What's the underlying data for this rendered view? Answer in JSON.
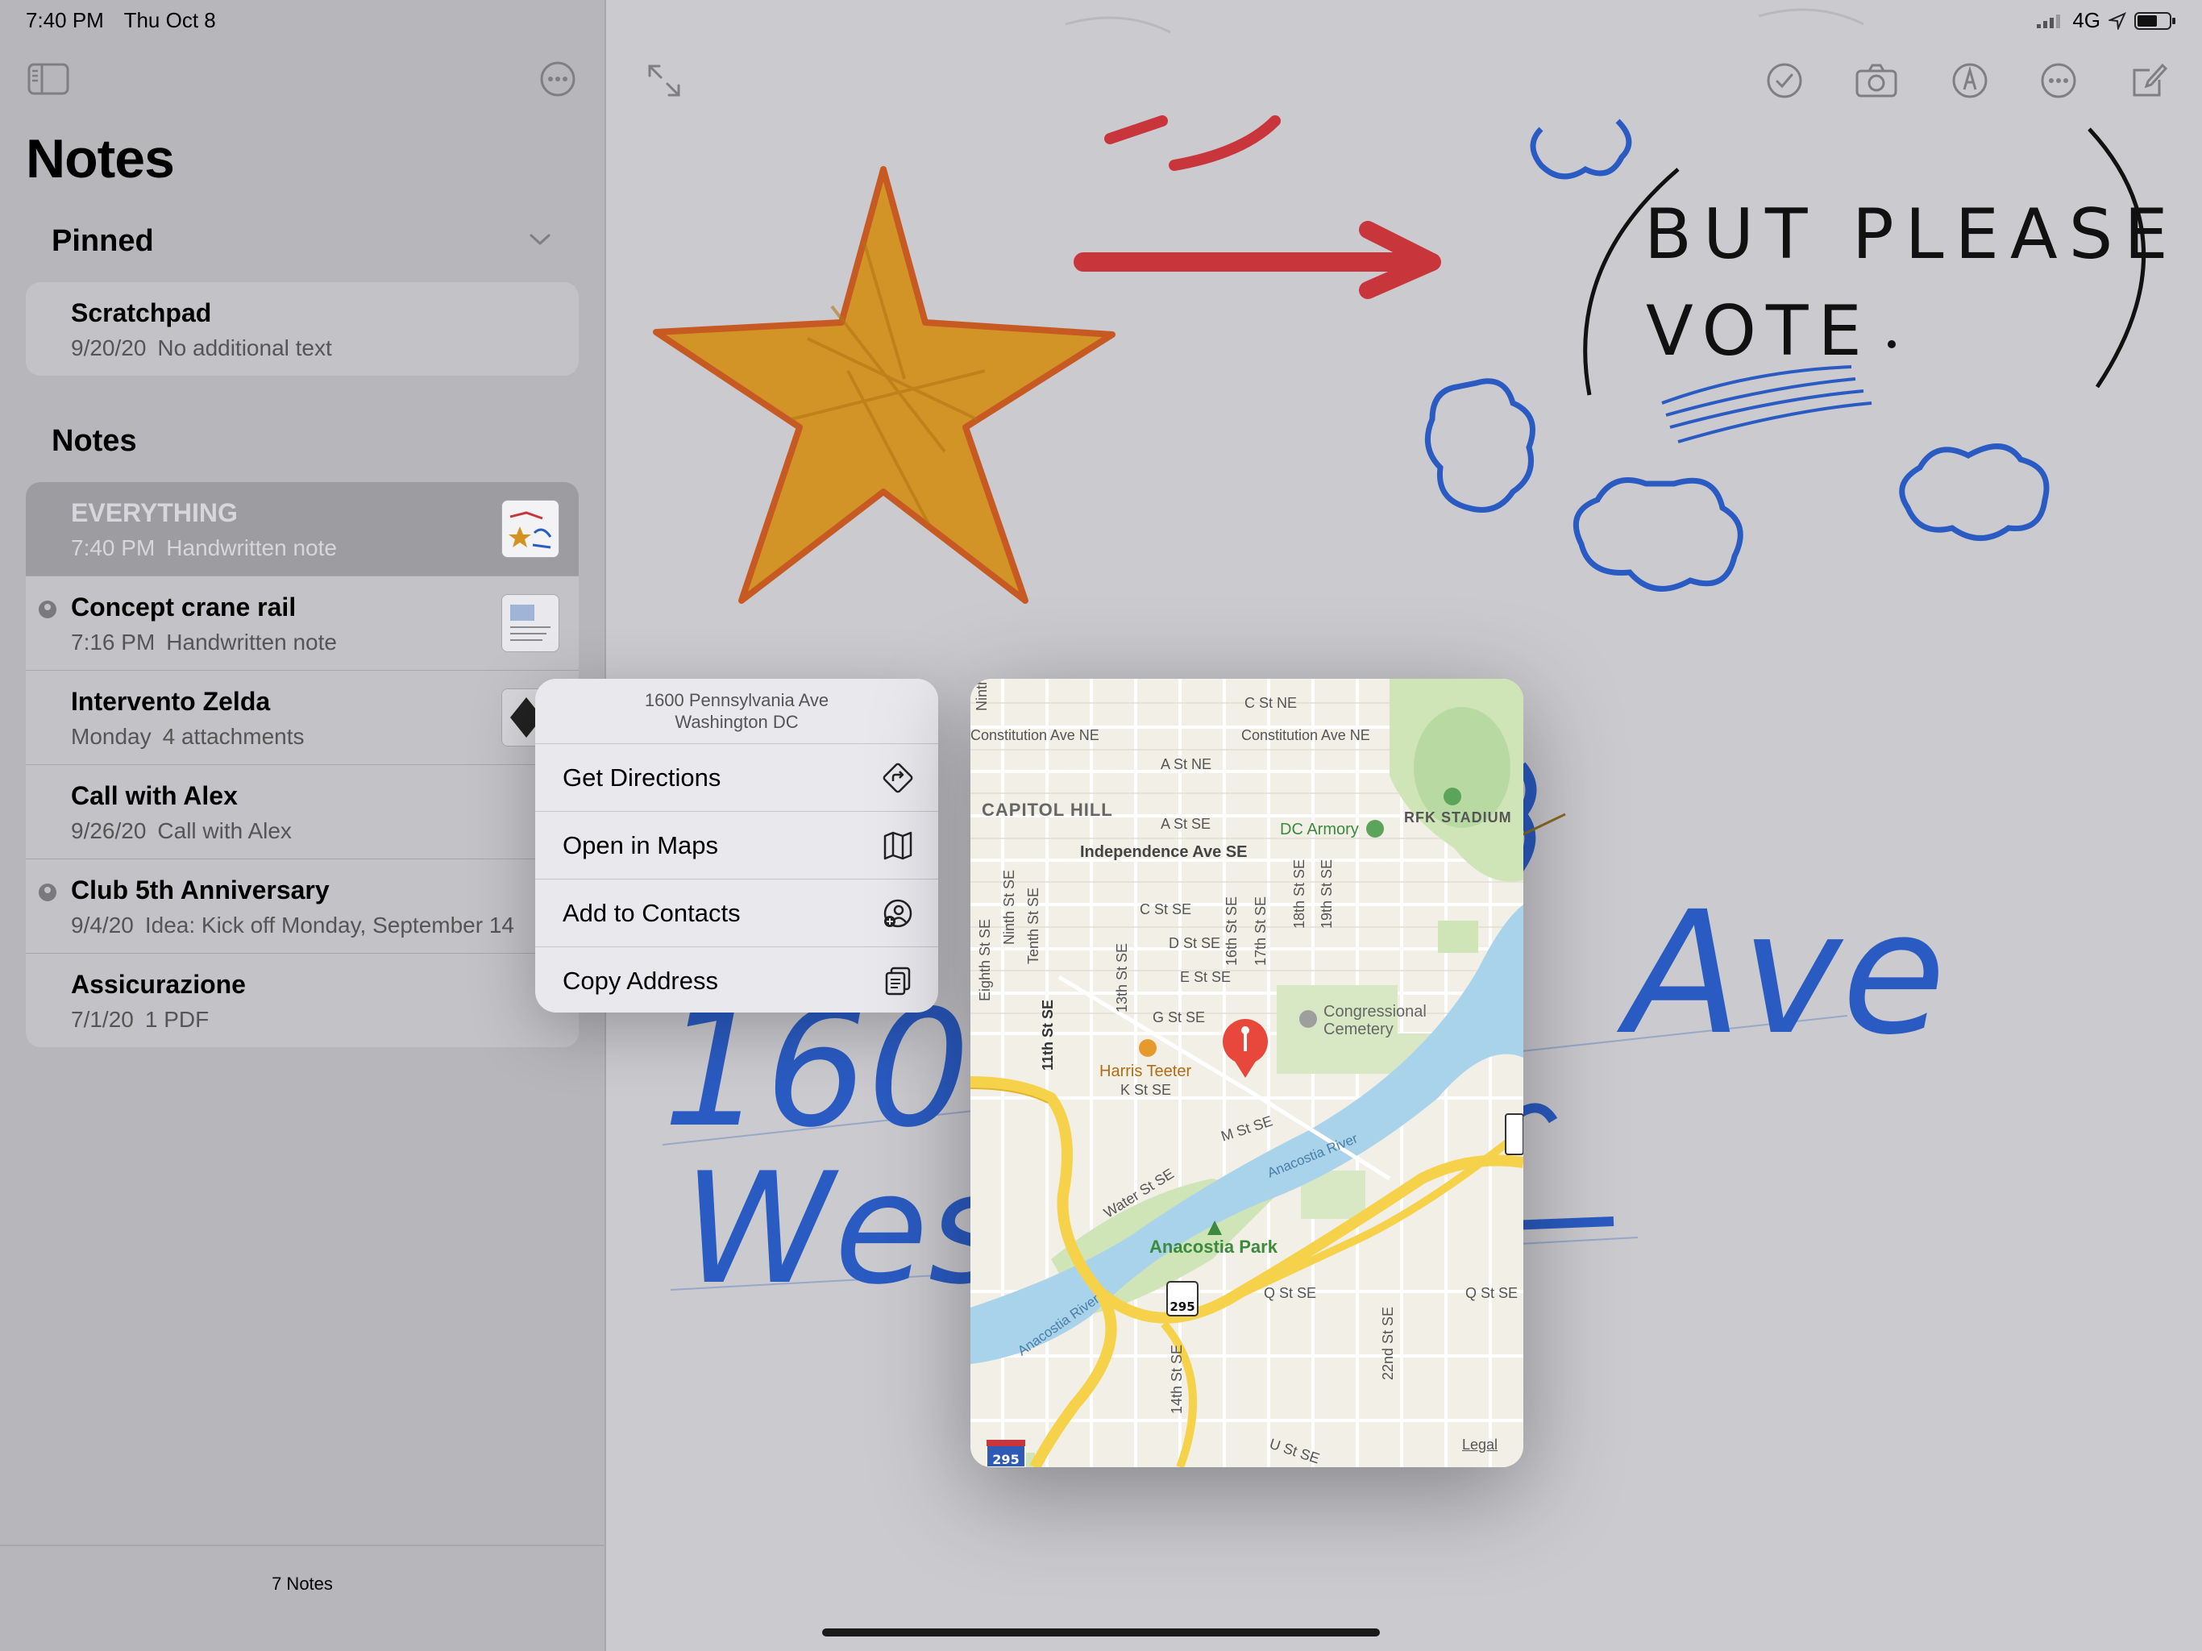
{
  "status": {
    "time": "7:40 PM",
    "date": "Thu Oct 8",
    "network": "4G"
  },
  "sidebar": {
    "title": "Notes",
    "pinned_header": "Pinned",
    "notes_header": "Notes",
    "pinned": [
      {
        "title": "Scratchpad",
        "date": "9/20/20",
        "preview": "No additional text"
      }
    ],
    "notes": [
      {
        "title": "EVERYTHING",
        "date": "7:40 PM",
        "preview": "Handwritten note",
        "selected": true
      },
      {
        "title": "Concept crane rail",
        "date": "7:16 PM",
        "preview": "Handwritten note",
        "shared": true
      },
      {
        "title": "Intervento Zelda",
        "date": "Monday",
        "preview": "4 attachments"
      },
      {
        "title": "Call with Alex",
        "date": "9/26/20",
        "preview": "Call with Alex"
      },
      {
        "title": "Club 5th Anniversary",
        "date": "9/4/20",
        "preview": "Idea: Kick off Monday, September 14",
        "shared": true
      },
      {
        "title": "Assicurazione",
        "date": "7/1/20",
        "preview": "1 PDF"
      }
    ],
    "footer": "7 Notes"
  },
  "context_menu": {
    "address_line1": "1600 Pennsylvania Ave",
    "address_line2": "Washington DC",
    "items": [
      {
        "label": "Get Directions",
        "icon": "directions-icon"
      },
      {
        "label": "Open in Maps",
        "icon": "map-icon"
      },
      {
        "label": "Add to Contacts",
        "icon": "add-contact-icon"
      },
      {
        "label": "Copy Address",
        "icon": "copy-icon"
      }
    ]
  },
  "map": {
    "legal": "Legal",
    "shields": [
      "295",
      "295"
    ],
    "labels": {
      "capitol_hill": "CAPITOL HILL",
      "independence": "Independence Ave SE",
      "constitution1": "Constitution Ave NE",
      "constitution2": "Constitution Ave NE",
      "a_st_ne": "A St NE",
      "c_st_ne": "C St NE",
      "a_st_se": "A St SE",
      "c_st_se": "C St SE",
      "d_st_se": "D St SE",
      "e_st_se": "E St SE",
      "g_st_se": "G St SE",
      "k_st_se": "K St SE",
      "m_st_se": "M St SE",
      "q_st_se1": "Q St SE",
      "q_st_se2": "Q St SE",
      "u_st_se": "U St SE",
      "water_st": "Water St SE",
      "dc_armory": "DC Armory",
      "rfk": "RFK STADIUM",
      "congressional": "Congressional",
      "cemetery": "Cemetery",
      "harris": "Harris Teeter",
      "anacostia_park": "Anacostia Park",
      "anacostia_river1": "Anacostia River",
      "anacostia_river2": "Anacostia River",
      "eleventh": "11th St SE",
      "thirteenth": "13th St SE",
      "fifteenth": "16th St SE",
      "seventeenth": "17th St SE",
      "eighteenth": "18th St SE",
      "nineteenth": "19th St SE",
      "ninth": "Ninth St SE",
      "tenth": "Tenth St SE",
      "eighth": "Eighth St SE",
      "fourteenth": "14th St SE",
      "twentysecond": "22nd St SE"
    }
  },
  "ink": {
    "vote_text": "BUT PLEASE",
    "vote_text2": "VOTE",
    "address_text1": "1600 P",
    "address_text2": "Ave",
    "address_text3": "Weshi"
  },
  "colors": {
    "star_fill": "#d4921f",
    "star_stroke": "#c7551a",
    "arrow": "#c8363c",
    "ink_blue": "#2a5bc2"
  }
}
